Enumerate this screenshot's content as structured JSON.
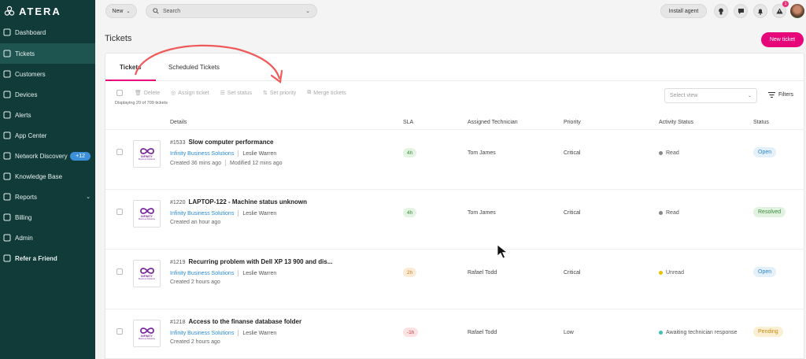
{
  "brand": {
    "name": "ATERA"
  },
  "sidebar": {
    "items": [
      {
        "label": "Dashboard",
        "icon": "dashboard-icon"
      },
      {
        "label": "Tickets",
        "icon": "tickets-icon",
        "active": true
      },
      {
        "label": "Customers",
        "icon": "customers-icon"
      },
      {
        "label": "Devices",
        "icon": "devices-icon"
      },
      {
        "label": "Alerts",
        "icon": "alerts-icon"
      },
      {
        "label": "App Center",
        "icon": "app-center-icon"
      },
      {
        "label": "Network Discovery",
        "icon": "network-icon",
        "badge": "+12"
      },
      {
        "label": "Knowledge Base",
        "icon": "knowledge-icon"
      },
      {
        "label": "Reports",
        "icon": "reports-icon",
        "caret": "⌄"
      },
      {
        "label": "Billing",
        "icon": "billing-icon"
      },
      {
        "label": "Admin",
        "icon": "admin-icon"
      },
      {
        "label": "Refer a Friend",
        "icon": "gift-icon"
      }
    ]
  },
  "topbar": {
    "new_label": "New",
    "search_placeholder": "Search",
    "install_label": "Install agent",
    "notification_count": "1"
  },
  "page": {
    "title": "Tickets",
    "new_ticket_label": "New ticket"
  },
  "tabs": {
    "tickets": "Tickets",
    "scheduled": "Scheduled Tickets"
  },
  "actions": {
    "delete": "Delete",
    "assign": "Assign ticket",
    "set_status": "Set status",
    "set_priority": "Set priority",
    "merge": "Merge tickets",
    "displaying": "Displaying 20 of 709 tickets",
    "select_view": "Select view",
    "filters": "Filters"
  },
  "columns": {
    "details": "Details",
    "sla": "SLA",
    "technician": "Assigned Technician",
    "priority": "Priority",
    "activity": "Activity Status",
    "status": "Status"
  },
  "company_logo": {
    "line1": "INFINITY",
    "line2": "Business Solutions"
  },
  "tickets": [
    {
      "id": "#1533",
      "title": "Slow computer performance",
      "company": "Infinity Business Solutions",
      "person": "Leslie Warren",
      "created": "Created 36 mins ago",
      "modified": "Modified 12 mins ago",
      "sla": "4h",
      "sla_color": "green",
      "technician": "Tom James",
      "priority": "Critical",
      "activity": "Read",
      "activity_color": "#888888",
      "status": "Open",
      "status_class": "open"
    },
    {
      "id": "#1220",
      "title": "LAPTOP-122 - Machine status unknown",
      "company": "Infinity Business Solutions",
      "person": "Leslie Warren",
      "created": "Created an hour ago",
      "modified": "",
      "sla": "4h",
      "sla_color": "green",
      "technician": "Tom James",
      "priority": "Critical",
      "activity": "Read",
      "activity_color": "#888888",
      "status": "Resolved",
      "status_class": "resolved"
    },
    {
      "id": "#1219",
      "title": "Recurring problem with Dell XP 13 900 and dis...",
      "company": "Infinity Business Solutions",
      "person": "Leslie Warren",
      "created": "Created 2 hours ago",
      "modified": "",
      "sla": "2h",
      "sla_color": "orange",
      "technician": "Rafael Todd",
      "priority": "Critical",
      "activity": "Unread",
      "activity_color": "#e6c200",
      "status": "Open",
      "status_class": "open"
    },
    {
      "id": "#1218",
      "title": "Access to the finanse database folder",
      "company": "Infinity Business Solutions",
      "person": "Leslie Warren",
      "created": "Created 2 hours ago",
      "modified": "",
      "sla": "-1h",
      "sla_color": "red",
      "technician": "Rafael Todd",
      "priority": "Low",
      "activity": "Awaiting technician response",
      "activity_color": "#3fc0b8",
      "status": "Pending",
      "status_class": "pending"
    }
  ]
}
